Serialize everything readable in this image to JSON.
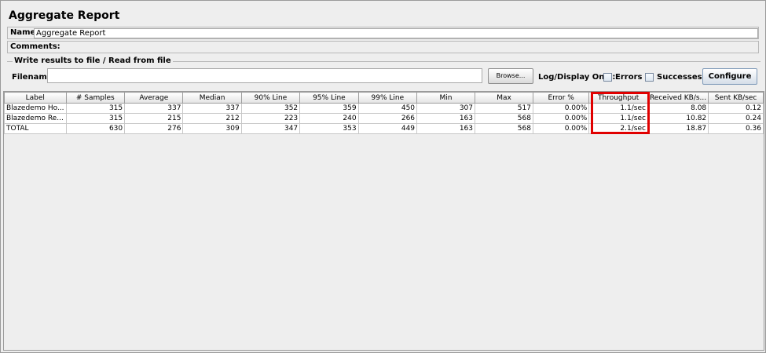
{
  "title": "Aggregate Report",
  "name_label": "Name:",
  "name_value": "Aggregate Report",
  "comments_label": "Comments:",
  "file_group_label": "Write results to file / Read from file",
  "filename_label": "Filename",
  "filename_value": "",
  "browse_label": "Browse...",
  "log_display_label": "Log/Display Only:",
  "errors_label": "Errors",
  "successes_label": "Successes",
  "configure_label": "Configure",
  "table": {
    "columns": [
      "Label",
      "# Samples",
      "Average",
      "Median",
      "90% Line",
      "95% Line",
      "99% Line",
      "Min",
      "Max",
      "Error %",
      "Throughput",
      "Received KB/s...",
      "Sent KB/sec"
    ],
    "rows": [
      [
        "Blazedemo Ho...",
        "315",
        "337",
        "337",
        "352",
        "359",
        "450",
        "307",
        "517",
        "0.00%",
        "1.1/sec",
        "8.08",
        "0.12"
      ],
      [
        "Blazedemo Re...",
        "315",
        "215",
        "212",
        "223",
        "240",
        "266",
        "163",
        "568",
        "0.00%",
        "1.1/sec",
        "10.82",
        "0.24"
      ],
      [
        "TOTAL",
        "630",
        "276",
        "309",
        "347",
        "353",
        "449",
        "163",
        "568",
        "0.00%",
        "2.1/sec",
        "18.87",
        "0.36"
      ]
    ]
  },
  "highlight_color": "#e00000"
}
